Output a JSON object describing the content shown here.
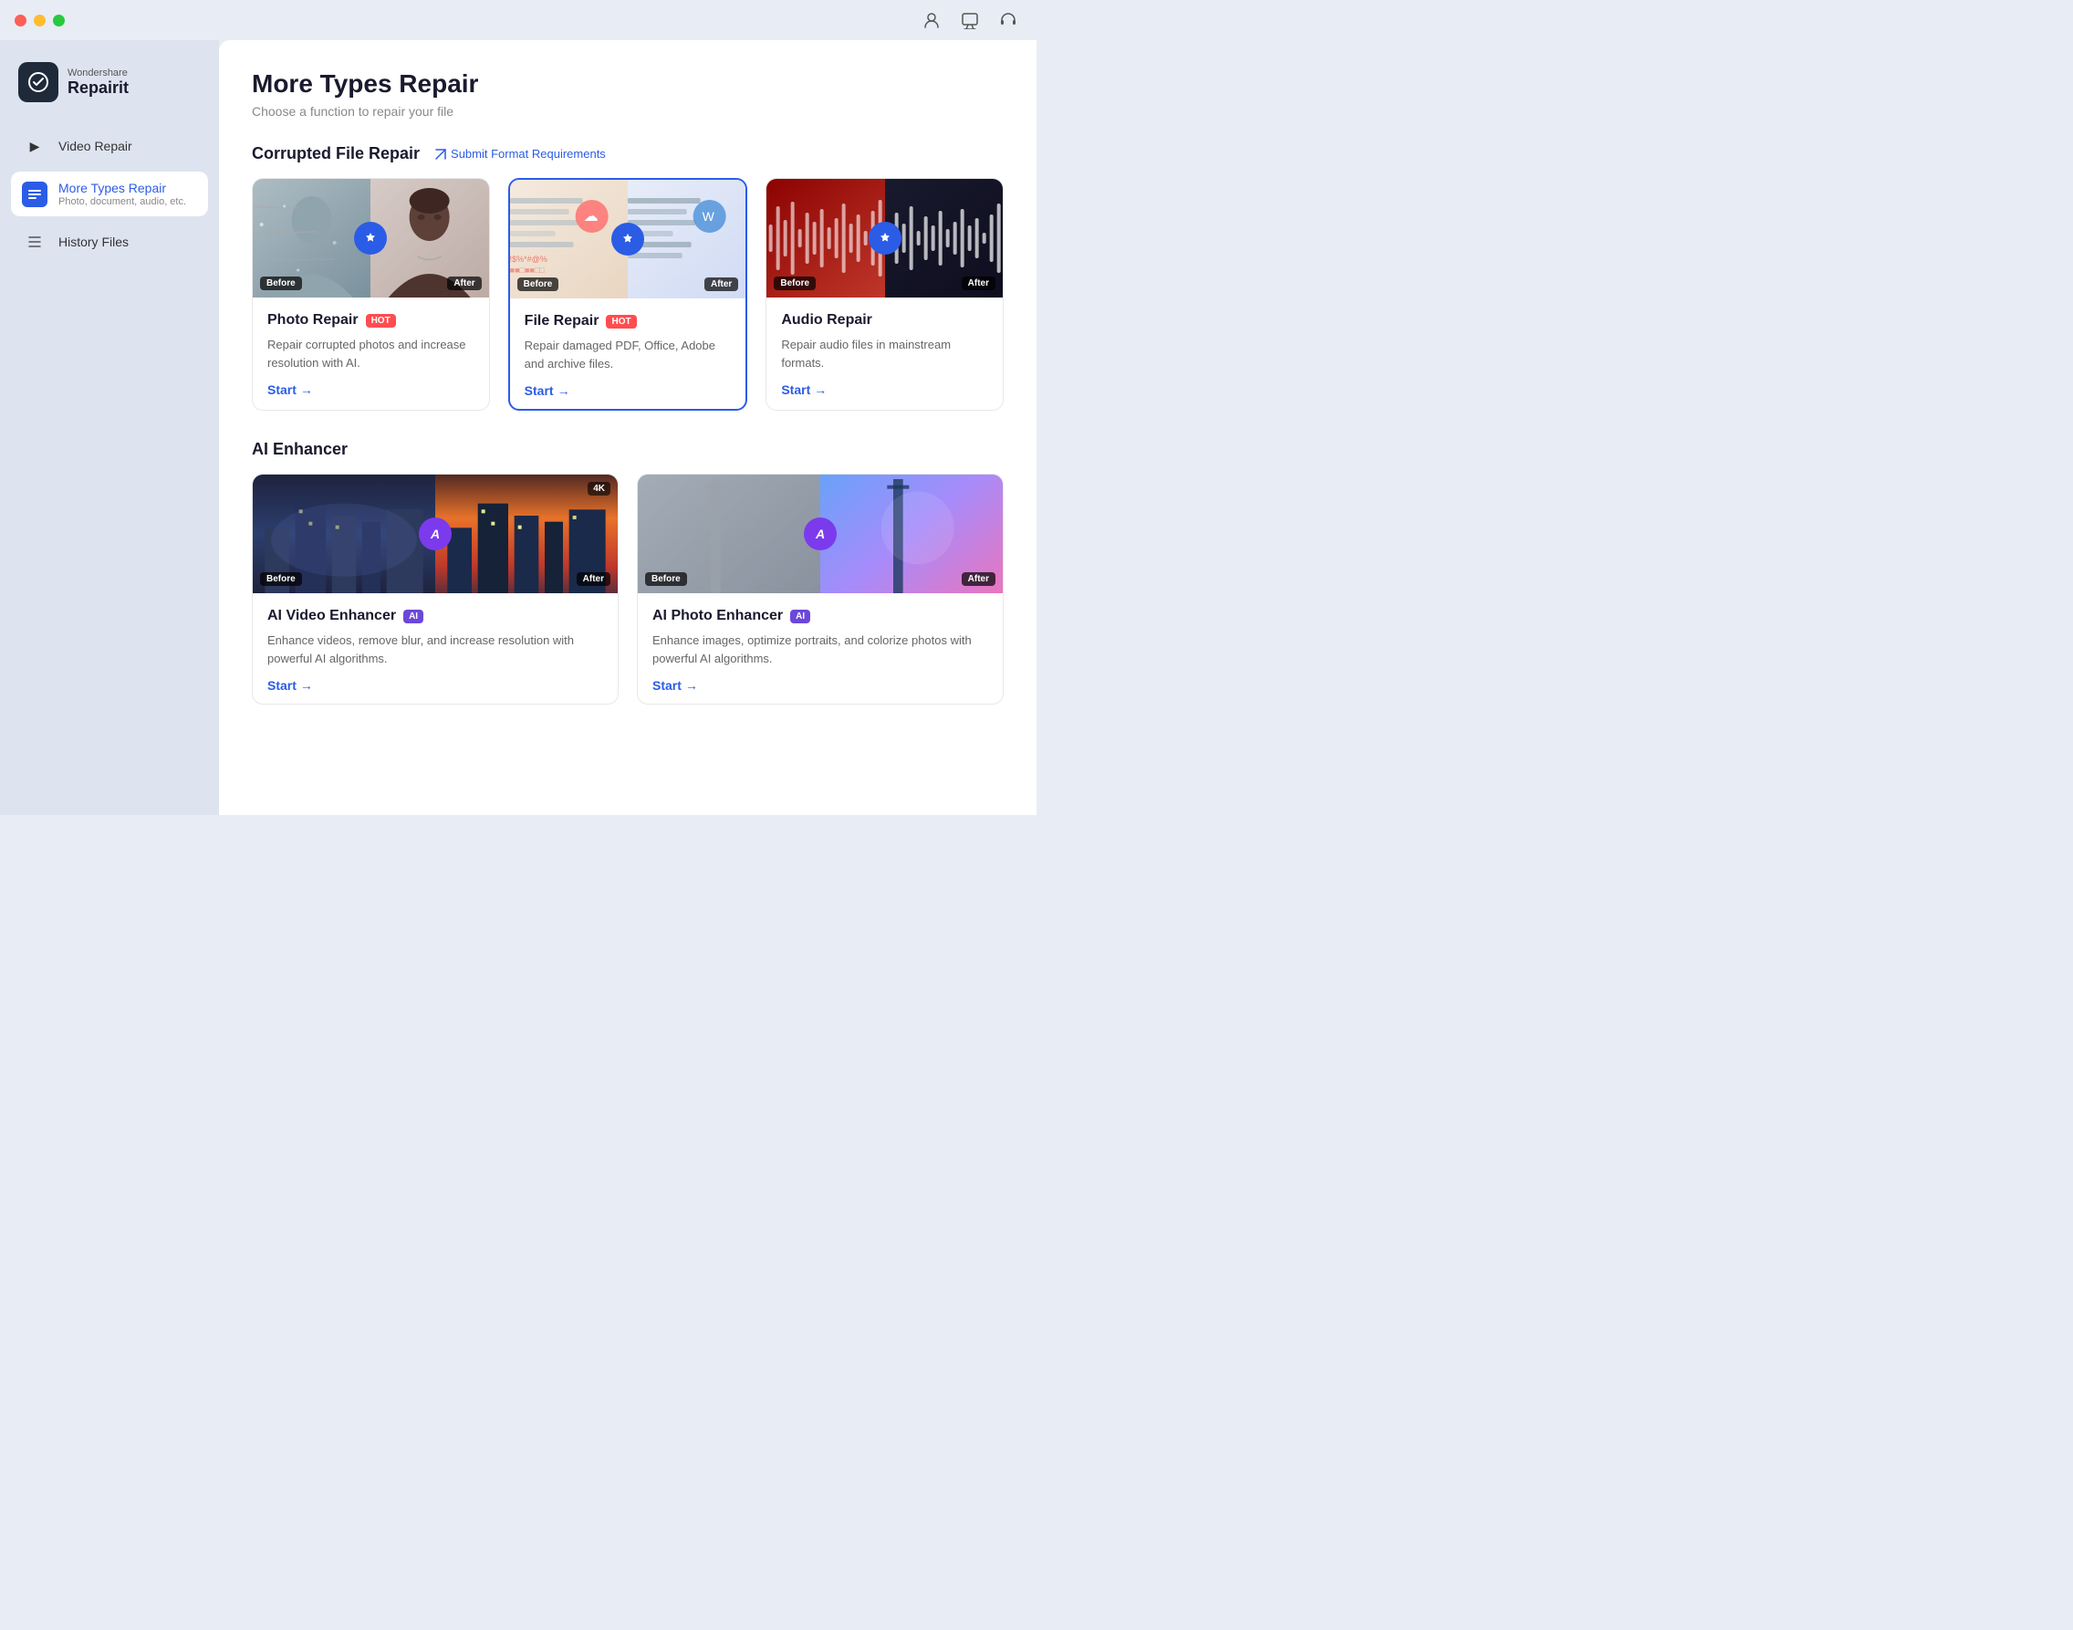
{
  "window": {
    "title": "Wondershare Repairit"
  },
  "titlebar": {
    "icons": [
      "person-icon",
      "chat-icon",
      "headset-icon"
    ]
  },
  "sidebar": {
    "logo": {
      "brand": "Wondershare",
      "name": "Repairit"
    },
    "items": [
      {
        "id": "video-repair",
        "label": "Video Repair",
        "icon": "▶",
        "active": false
      },
      {
        "id": "more-types-repair",
        "label": "More Types Repair",
        "sub": "Photo, document, audio, etc.",
        "icon": "◆",
        "active": true
      },
      {
        "id": "history-files",
        "label": "History Files",
        "icon": "≡",
        "active": false
      }
    ]
  },
  "main": {
    "title": "More Types Repair",
    "subtitle": "Choose a function to repair your file",
    "sections": {
      "corrupted": {
        "title": "Corrupted File Repair",
        "submit_link": "Submit Format Requirements",
        "cards": [
          {
            "id": "photo-repair",
            "title": "Photo Repair",
            "badge": "HOT",
            "badge_type": "hot",
            "description": "Repair corrupted photos and increase resolution with AI.",
            "start_label": "Start",
            "active": false
          },
          {
            "id": "file-repair",
            "title": "File Repair",
            "badge": "HOT",
            "badge_type": "hot",
            "description": "Repair damaged PDF, Office, Adobe and archive files.",
            "start_label": "Start",
            "active": true
          },
          {
            "id": "audio-repair",
            "title": "Audio Repair",
            "badge": null,
            "description": "Repair audio files in mainstream formats.",
            "start_label": "Start",
            "active": false
          }
        ]
      },
      "ai_enhancer": {
        "title": "AI Enhancer",
        "cards": [
          {
            "id": "ai-video-enhancer",
            "title": "AI Video Enhancer",
            "badge": "AI",
            "badge_type": "ai",
            "description": "Enhance videos, remove blur, and increase resolution with powerful AI algorithms.",
            "start_label": "Start"
          },
          {
            "id": "ai-photo-enhancer",
            "title": "AI Photo Enhancer",
            "badge": "AI",
            "badge_type": "ai",
            "description": "Enhance images, optimize portraits, and colorize photos with powerful AI algorithms.",
            "start_label": "Start"
          }
        ]
      }
    }
  }
}
